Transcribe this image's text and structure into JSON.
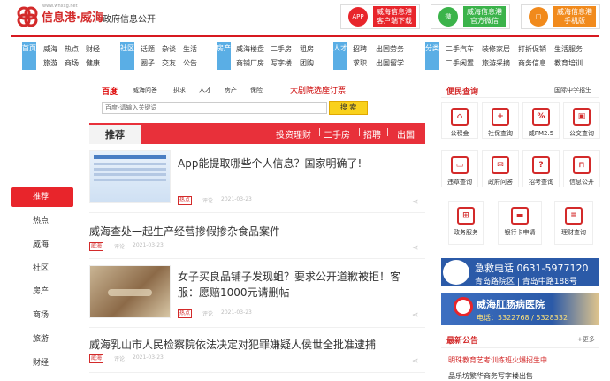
{
  "header": {
    "logo_text": "信息港·威海",
    "logo_sub": "www.whxxg.net",
    "gov_link": "政府信息公开",
    "buttons": [
      {
        "icon": "APP",
        "label1": "威海信息港",
        "label2": "客户端下载",
        "color": "#e8252b"
      },
      {
        "icon": "微",
        "label1": "威海信息港",
        "label2": "官方微信",
        "color": "#3bb34a"
      },
      {
        "icon": "□",
        "label1": "威海信息港",
        "label2": "手机版",
        "color": "#f18a1c"
      }
    ]
  },
  "nav": {
    "cats": [
      {
        "label": "首页",
        "links": [
          "威海",
          "热点",
          "财经",
          "旅游",
          "商场",
          "健康"
        ]
      },
      {
        "label": "社区",
        "links": [
          "话题",
          "杂谈",
          "生活",
          "圈子",
          "交友",
          "公告"
        ]
      },
      {
        "label": "房产",
        "links": [
          "威海楼盘",
          "二手房",
          "租房",
          "商铺厂房",
          "写字楼",
          "团购"
        ]
      },
      {
        "label": "人才",
        "links": [
          "招聘",
          "出国劳务",
          "求职",
          "出国留学"
        ]
      },
      {
        "label": "分类",
        "links": [
          "二手汽车",
          "装修家居",
          "打折促销",
          "生活服务",
          "二手闲置",
          "旅游采摘",
          "商务信息",
          "教育培训"
        ]
      }
    ]
  },
  "left_rail": [
    "推荐",
    "热点",
    "威海",
    "社区",
    "房产",
    "商场",
    "旅游",
    "财经"
  ],
  "search": {
    "brand": "百度",
    "tabs": [
      "威海问答",
      "拱求",
      "人才",
      "房产",
      "保险"
    ],
    "promo": "大剧院选座订票",
    "placeholder": "百度-请输入关键词",
    "button": "搜 索"
  },
  "recommend": {
    "title": "推荐",
    "links": [
      "投资理财",
      "二手房",
      "招聘",
      "出国"
    ]
  },
  "feed": [
    {
      "title": "App能提取哪些个人信息？国家明确了!",
      "tag": "热点",
      "comment": "评论",
      "date": "2021-03-23"
    },
    {
      "title": "威海查处一起生产经营掺假掺杂食品案件",
      "tag": "威海",
      "comment": "评论",
      "date": "2021-03-23"
    },
    {
      "title": "女子买良品铺子发现蛆？要求公开道歉被拒！客服：愿赔1000元请删帖",
      "tag": "热点",
      "comment": "评论",
      "date": "2021-03-23"
    },
    {
      "title": "威海乳山市人民检察院依法决定对犯罪嫌疑人侯世全批准逮捕",
      "tag": "威海",
      "comment": "评论",
      "date": "2021-03-23"
    }
  ],
  "services": {
    "title": "便民查询",
    "extra": "国际中学招生",
    "tiles": [
      {
        "label": "公积金",
        "icon": "⌂"
      },
      {
        "label": "社保查询",
        "icon": "+"
      },
      {
        "label": "威PM2.5",
        "icon": "%"
      },
      {
        "label": "公交查询",
        "icon": "▣"
      },
      {
        "label": "违章查询",
        "icon": "▭"
      },
      {
        "label": "政府问答",
        "icon": "✉"
      },
      {
        "label": "招考查询",
        "icon": "?"
      },
      {
        "label": "信息公开",
        "icon": "⊓"
      },
      {
        "label": "政务服务",
        "icon": "⊞"
      },
      {
        "label": "银行卡申请",
        "icon": "▬"
      },
      {
        "label": "理财查询",
        "icon": "≡"
      }
    ]
  },
  "ads": [
    {
      "line1": "急救电话 0631-5977120",
      "line2": "青岛路院区 | 青岛中路188号"
    },
    {
      "line1": "威海肛肠病医院",
      "line2": "电话：5322768 / 5328332"
    }
  ],
  "announcements": {
    "title": "最新公告",
    "more": "+更多",
    "items": [
      "明珠教育艺考训练班火爆招生中",
      "品乐坊繁华商务写字楼出售"
    ]
  }
}
